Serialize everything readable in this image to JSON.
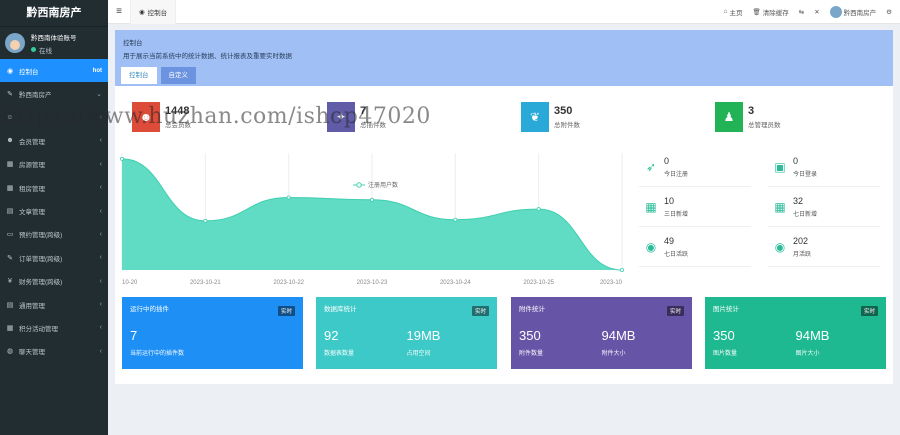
{
  "sidebar": {
    "brand": "黔西南房产",
    "user": {
      "name": "黔西南体验账号",
      "status": "在线"
    },
    "items": [
      {
        "label": "控制台",
        "icon": "dashboard-icon",
        "glyph": "◉",
        "badge": "hot",
        "active": true
      },
      {
        "label": "黔西南房产",
        "icon": "pencil-icon",
        "glyph": "✎",
        "arrow": "⌄"
      },
      {
        "label": "",
        "icon": "user-icon",
        "glyph": "☺",
        "arrow": "‹"
      },
      {
        "label": "会员管理",
        "icon": "users-icon",
        "glyph": "☻",
        "arrow": "‹"
      },
      {
        "label": "房源管理",
        "icon": "grid-icon",
        "glyph": "▦",
        "arrow": "‹"
      },
      {
        "label": "租房管理",
        "icon": "grid-icon",
        "glyph": "▦",
        "arrow": "‹"
      },
      {
        "label": "文章管理",
        "icon": "file-icon",
        "glyph": "▤",
        "arrow": "‹"
      },
      {
        "label": "预约管理(跨级)",
        "icon": "monitor-icon",
        "glyph": "▭",
        "arrow": "‹"
      },
      {
        "label": "订单管理(跨级)",
        "icon": "wrench-icon",
        "glyph": "✎",
        "arrow": "‹"
      },
      {
        "label": "财务管理(跨级)",
        "icon": "money-icon",
        "glyph": "¥",
        "arrow": "‹"
      },
      {
        "label": "通用管理",
        "icon": "list-icon",
        "glyph": "▤",
        "arrow": "‹"
      },
      {
        "label": "积分活动管理",
        "icon": "grid-icon",
        "glyph": "▦",
        "arrow": "‹"
      },
      {
        "label": "聊天管理",
        "icon": "chat-icon",
        "glyph": "◍",
        "arrow": "‹"
      }
    ]
  },
  "topbar": {
    "tab_label": "控制台",
    "home": "主页",
    "clear_cache": "清除缓存",
    "user": "黔西南房产"
  },
  "banner": {
    "title": "控制台",
    "desc": "用于展示当前系统中的统计数据、统计报表及重要实时数据",
    "tabs": [
      "控制台",
      "自定义"
    ]
  },
  "stats": [
    {
      "value": "1448",
      "label": "总会员数",
      "color": "#dd4b39",
      "icon": "users-icon",
      "glyph": "☻"
    },
    {
      "value": "7",
      "label": "总插件数",
      "color": "#605ca8",
      "icon": "magic-wand-icon",
      "glyph": "✦"
    },
    {
      "value": "350",
      "label": "总附件数",
      "color": "#29a9d8",
      "icon": "leaf-icon",
      "glyph": "❦"
    },
    {
      "value": "3",
      "label": "总管理员数",
      "color": "#21b356",
      "icon": "user-icon",
      "glyph": "♟"
    }
  ],
  "chart_data": {
    "type": "area",
    "legend": "注册用户数",
    "x": [
      "10-20",
      "2023-10-21",
      "2023-10-22",
      "2023-10-23",
      "2023-10-24",
      "2023-10-25",
      "2023-10"
    ],
    "values": [
      95,
      42,
      62,
      60,
      43,
      52,
      0
    ],
    "ylim": [
      0,
      100
    ],
    "color": "#5fdcc3"
  },
  "mini_stats": [
    {
      "value": "0",
      "label": "今日注册",
      "icon": "rocket-icon",
      "glyph": "➶"
    },
    {
      "value": "0",
      "label": "今日登录",
      "icon": "id-card-icon",
      "glyph": "▣"
    },
    {
      "value": "10",
      "label": "三日新增",
      "icon": "calendar-icon",
      "glyph": "▦"
    },
    {
      "value": "32",
      "label": "七日新增",
      "icon": "calendar-plus-icon",
      "glyph": "▦"
    },
    {
      "value": "49",
      "label": "七日活跃",
      "icon": "user-circle-icon",
      "glyph": "◉"
    },
    {
      "value": "202",
      "label": "月活跃",
      "icon": "user-circle-icon",
      "glyph": "◉"
    }
  ],
  "cards": [
    {
      "title": "运行中的插件",
      "badge": "实时",
      "color": "#1e90f5",
      "cols": [
        {
          "value": "7",
          "sub": "当前运行中的插件数"
        }
      ]
    },
    {
      "title": "数据库统计",
      "badge": "实时",
      "color": "#3ec9c9",
      "cols": [
        {
          "value": "92",
          "sub": "数据表数量"
        },
        {
          "value": "19MB",
          "sub": "占用空间"
        }
      ]
    },
    {
      "title": "附件统计",
      "badge": "实时",
      "color": "#6654a6",
      "cols": [
        {
          "value": "350",
          "sub": "附件数量"
        },
        {
          "value": "94MB",
          "sub": "附件大小"
        }
      ]
    },
    {
      "title": "图片统计",
      "badge": "实时",
      "color": "#1fb991",
      "cols": [
        {
          "value": "350",
          "sub": "图片数量"
        },
        {
          "value": "94MB",
          "sub": "图片大小"
        }
      ]
    }
  ],
  "watermark": "https://www.huzhan.com/ishop47020"
}
